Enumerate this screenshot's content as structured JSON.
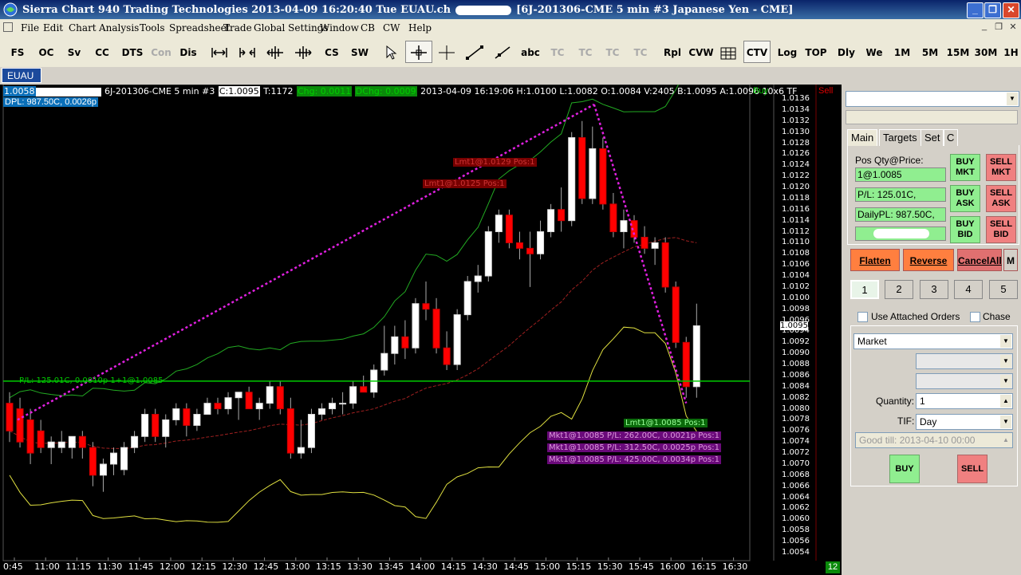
{
  "window": {
    "title": "Sierra Chart 940 Trading Technologies 2013-04-09  16:20:40 Tue  EUAU.ch",
    "title_suffix": "[6J-201306-CME  5 min  #3  Japanese Yen - CME]"
  },
  "menu": [
    "File",
    "Edit",
    "Chart",
    "Analysis",
    "Tools",
    "Spreadsheet",
    "Trade",
    "Global Settings",
    "Window",
    "CB",
    "CW",
    "Help"
  ],
  "toolbar": {
    "buttons": [
      "FS",
      "OC",
      "Sv",
      "CC",
      "DTS",
      "Con",
      "Dis",
      "CS",
      "SW",
      "abc",
      "TC 1",
      "TC 2",
      "TC 3",
      "TC 4",
      "Rpl",
      "CVW",
      "CTV",
      "Log",
      "TOP",
      "Dly",
      "We",
      "1M",
      "5M",
      "15M",
      "30M",
      "1H"
    ]
  },
  "tabs": [
    "EUAU"
  ],
  "chart": {
    "info_price": "1.0058",
    "info_symbol": "6J-201306-CME  5 min  #3",
    "info_close": "C:1.0095",
    "info_trades": "T:1172",
    "info_chg": "Chg: 0.0011",
    "info_dchg": "DChg: 0.0009",
    "info_rest": "2013-04-09 16:19:06 H:1.0100 L:1.0082 O:1.0084 V:2405 B:1.0095 A:1.0096 10x6 TF",
    "buy_label": "Buy",
    "sell_label": "Sell",
    "dpl": "DPL: 987.50C, 0.0026p",
    "current_price": "1.0095",
    "bar_count": "12",
    "pl_line_label": "P/L: 125.01C, 0.0010p 1+1@1.0085",
    "orders": {
      "lmt1": "Lmt1@1.0129 Pos:1",
      "lmt2": "Lmt1@1.0125 Pos:1",
      "lmt3": "Lmt1@1.0085 Pos:1",
      "mkt1": "Mkt1@1.0085 P/L: 262.00C, 0.0021p Pos:1",
      "mkt2": "Mkt1@1.0085 P/L: 312.50C, 0.0025p Pos:1",
      "mkt3": "Mkt1@1.0085 P/L: 425.00C, 0.0034p Pos:1"
    },
    "price_labels": [
      "1.0136",
      "1.0134",
      "1.0132",
      "1.0130",
      "1.0128",
      "1.0126",
      "1.0124",
      "1.0122",
      "1.0120",
      "1.0118",
      "1.0116",
      "1.0114",
      "1.0112",
      "1.0110",
      "1.0108",
      "1.0106",
      "1.0104",
      "1.0102",
      "1.0100",
      "1.0098",
      "1.0096",
      "1.0094",
      "1.0092",
      "1.0090",
      "1.0088",
      "1.0086",
      "1.0084",
      "1.0082",
      "1.0080",
      "1.0078",
      "1.0076",
      "1.0074",
      "1.0072",
      "1.0070",
      "1.0068",
      "1.0066",
      "1.0064",
      "1.0062",
      "1.0060",
      "1.0058",
      "1.0056",
      "1.0054"
    ],
    "time_labels": [
      "0:45",
      "11:00",
      "11:15",
      "11:30",
      "11:45",
      "12:00",
      "12:15",
      "12:30",
      "12:45",
      "13:00",
      "13:15",
      "13:30",
      "13:45",
      "14:00",
      "14:15",
      "14:30",
      "14:45",
      "15:00",
      "15:15",
      "15:30",
      "15:45",
      "16:00",
      "16:15",
      "16:30"
    ]
  },
  "chart_data": {
    "type": "candlestick",
    "symbol": "6J-201306-CME",
    "interval": "5 min",
    "ylim": [
      1.0052,
      1.0137
    ],
    "candles": [
      {
        "o": 1.0081,
        "h": 1.0083,
        "l": 1.0074,
        "c": 1.0076
      },
      {
        "o": 1.008,
        "h": 1.0082,
        "l": 1.0073,
        "c": 1.0074
      },
      {
        "o": 1.0078,
        "h": 1.008,
        "l": 1.007,
        "c": 1.0072
      },
      {
        "o": 1.0076,
        "h": 1.0078,
        "l": 1.0072,
        "c": 1.0073
      },
      {
        "o": 1.0073,
        "h": 1.0075,
        "l": 1.007,
        "c": 1.0074
      },
      {
        "o": 1.0073,
        "h": 1.0076,
        "l": 1.0072,
        "c": 1.0074
      },
      {
        "o": 1.0073,
        "h": 1.0075,
        "l": 1.0071,
        "c": 1.0075
      },
      {
        "o": 1.0075,
        "h": 1.0076,
        "l": 1.0071,
        "c": 1.0073
      },
      {
        "o": 1.0073,
        "h": 1.0074,
        "l": 1.0066,
        "c": 1.0068
      },
      {
        "o": 1.0068,
        "h": 1.0071,
        "l": 1.0065,
        "c": 1.007
      },
      {
        "o": 1.007,
        "h": 1.0073,
        "l": 1.0068,
        "c": 1.0072
      },
      {
        "o": 1.0069,
        "h": 1.0074,
        "l": 1.0068,
        "c": 1.0073
      },
      {
        "o": 1.0073,
        "h": 1.0076,
        "l": 1.0072,
        "c": 1.0075
      },
      {
        "o": 1.0075,
        "h": 1.008,
        "l": 1.0074,
        "c": 1.0079
      },
      {
        "o": 1.0079,
        "h": 1.008,
        "l": 1.0074,
        "c": 1.0075
      },
      {
        "o": 1.0075,
        "h": 1.0079,
        "l": 1.0073,
        "c": 1.0078
      },
      {
        "o": 1.0078,
        "h": 1.0081,
        "l": 1.0077,
        "c": 1.008
      },
      {
        "o": 1.008,
        "h": 1.0081,
        "l": 1.0075,
        "c": 1.0077
      },
      {
        "o": 1.0077,
        "h": 1.008,
        "l": 1.0076,
        "c": 1.0079
      },
      {
        "o": 1.0079,
        "h": 1.0082,
        "l": 1.0079,
        "c": 1.0081
      },
      {
        "o": 1.0081,
        "h": 1.0082,
        "l": 1.0079,
        "c": 1.008
      },
      {
        "o": 1.008,
        "h": 1.0083,
        "l": 1.0079,
        "c": 1.0082
      },
      {
        "o": 1.0082,
        "h": 1.0083,
        "l": 1.0078,
        "c": 1.0083
      },
      {
        "o": 1.0083,
        "h": 1.0084,
        "l": 1.008,
        "c": 1.008
      },
      {
        "o": 1.008,
        "h": 1.0082,
        "l": 1.0078,
        "c": 1.0081
      },
      {
        "o": 1.0081,
        "h": 1.0085,
        "l": 1.008,
        "c": 1.0084
      },
      {
        "o": 1.0084,
        "h": 1.0085,
        "l": 1.0079,
        "c": 1.008
      },
      {
        "o": 1.008,
        "h": 1.0082,
        "l": 1.0071,
        "c": 1.0072
      },
      {
        "o": 1.0072,
        "h": 1.0078,
        "l": 1.0071,
        "c": 1.0073
      },
      {
        "o": 1.0073,
        "h": 1.008,
        "l": 1.0072,
        "c": 1.0079
      },
      {
        "o": 1.0079,
        "h": 1.0081,
        "l": 1.0078,
        "c": 1.008
      },
      {
        "o": 1.008,
        "h": 1.0082,
        "l": 1.0079,
        "c": 1.0081
      },
      {
        "o": 1.0081,
        "h": 1.0083,
        "l": 1.0079,
        "c": 1.0081
      },
      {
        "o": 1.0081,
        "h": 1.0085,
        "l": 1.008,
        "c": 1.0084
      },
      {
        "o": 1.0084,
        "h": 1.0086,
        "l": 1.0083,
        "c": 1.0083
      },
      {
        "o": 1.0083,
        "h": 1.0088,
        "l": 1.0082,
        "c": 1.0087
      },
      {
        "o": 1.0087,
        "h": 1.0095,
        "l": 1.0086,
        "c": 1.009
      },
      {
        "o": 1.009,
        "h": 1.0095,
        "l": 1.0088,
        "c": 1.0093
      },
      {
        "o": 1.0093,
        "h": 1.0096,
        "l": 1.0089,
        "c": 1.0091
      },
      {
        "o": 1.0091,
        "h": 1.01,
        "l": 1.009,
        "c": 1.0099
      },
      {
        "o": 1.0099,
        "h": 1.0103,
        "l": 1.0096,
        "c": 1.0098
      },
      {
        "o": 1.0098,
        "h": 1.01,
        "l": 1.009,
        "c": 1.0091
      },
      {
        "o": 1.0091,
        "h": 1.0094,
        "l": 1.0087,
        "c": 1.0088
      },
      {
        "o": 1.0088,
        "h": 1.0098,
        "l": 1.0087,
        "c": 1.0097
      },
      {
        "o": 1.0097,
        "h": 1.0104,
        "l": 1.0096,
        "c": 1.0103
      },
      {
        "o": 1.0103,
        "h": 1.0106,
        "l": 1.0101,
        "c": 1.0104
      },
      {
        "o": 1.0104,
        "h": 1.0113,
        "l": 1.0103,
        "c": 1.0112
      },
      {
        "o": 1.0112,
        "h": 1.0116,
        "l": 1.011,
        "c": 1.0115
      },
      {
        "o": 1.0115,
        "h": 1.0116,
        "l": 1.0109,
        "c": 1.011
      },
      {
        "o": 1.011,
        "h": 1.0112,
        "l": 1.0107,
        "c": 1.0109
      },
      {
        "o": 1.0109,
        "h": 1.0112,
        "l": 1.0102,
        "c": 1.0108
      },
      {
        "o": 1.0108,
        "h": 1.0114,
        "l": 1.0107,
        "c": 1.0112
      },
      {
        "o": 1.0112,
        "h": 1.0117,
        "l": 1.0111,
        "c": 1.0116
      },
      {
        "o": 1.0116,
        "h": 1.012,
        "l": 1.0112,
        "c": 1.0114
      },
      {
        "o": 1.0114,
        "h": 1.013,
        "l": 1.0113,
        "c": 1.0129
      },
      {
        "o": 1.0129,
        "h": 1.0132,
        "l": 1.0117,
        "c": 1.0118
      },
      {
        "o": 1.0118,
        "h": 1.0131,
        "l": 1.0117,
        "c": 1.0127
      },
      {
        "o": 1.0127,
        "h": 1.0129,
        "l": 1.0116,
        "c": 1.0117
      },
      {
        "o": 1.0117,
        "h": 1.0119,
        "l": 1.0111,
        "c": 1.0112
      },
      {
        "o": 1.0112,
        "h": 1.0116,
        "l": 1.0109,
        "c": 1.0114
      },
      {
        "o": 1.0114,
        "h": 1.0115,
        "l": 1.011,
        "c": 1.0111
      },
      {
        "o": 1.0111,
        "h": 1.0113,
        "l": 1.0108,
        "c": 1.0109
      },
      {
        "o": 1.0109,
        "h": 1.0111,
        "l": 1.0106,
        "c": 1.011
      },
      {
        "o": 1.011,
        "h": 1.0111,
        "l": 1.0101,
        "c": 1.0102
      },
      {
        "o": 1.0102,
        "h": 1.0103,
        "l": 1.0091,
        "c": 1.0092
      },
      {
        "o": 1.0092,
        "h": 1.0093,
        "l": 1.0082,
        "c": 1.0084
      },
      {
        "o": 1.0084,
        "h": 1.0099,
        "l": 1.0082,
        "c": 1.0095
      }
    ],
    "lines": {
      "position_pl": 1.0085
    }
  },
  "panel": {
    "tabs": [
      "Main",
      "Targets",
      "Set",
      "C"
    ],
    "pos_label": "Pos Qty@Price:",
    "pos_value": "1@1.0085",
    "pl_value": "P/L: 125.01C,",
    "daily_pl": "DailyPL: 987.50C,",
    "buy_mkt": "BUY MKT",
    "sell_mkt": "SELL MKT",
    "buy_ask": "BUY ASK",
    "sell_ask": "SELL ASK",
    "buy_bid": "BUY BID",
    "sell_bid": "SELL BID",
    "flatten": "Flatten",
    "reverse": "Reverse",
    "cancel_all": "CancelAll",
    "m_label": "M",
    "qty_buttons": [
      "1",
      "2",
      "3",
      "4",
      "5"
    ],
    "use_attached": "Use Attached Orders",
    "chase": "Chase",
    "order_type": "Market",
    "quantity_label": "Quantity:",
    "quantity_value": "1",
    "tif_label": "TIF:",
    "tif_value": "Day",
    "good_till": "Good till: 2013-04-10 00:00",
    "buy": "BUY",
    "sell": "SELL"
  },
  "colors": {
    "bg": "#000000",
    "up_candle": "#ffffff",
    "down_candle": "#ff0000",
    "bb_upper": "#22aa22",
    "bb_lower": "#e0e040",
    "ma": "#a02020",
    "trendline": "#e020e0",
    "pl_line": "#00cc00"
  }
}
